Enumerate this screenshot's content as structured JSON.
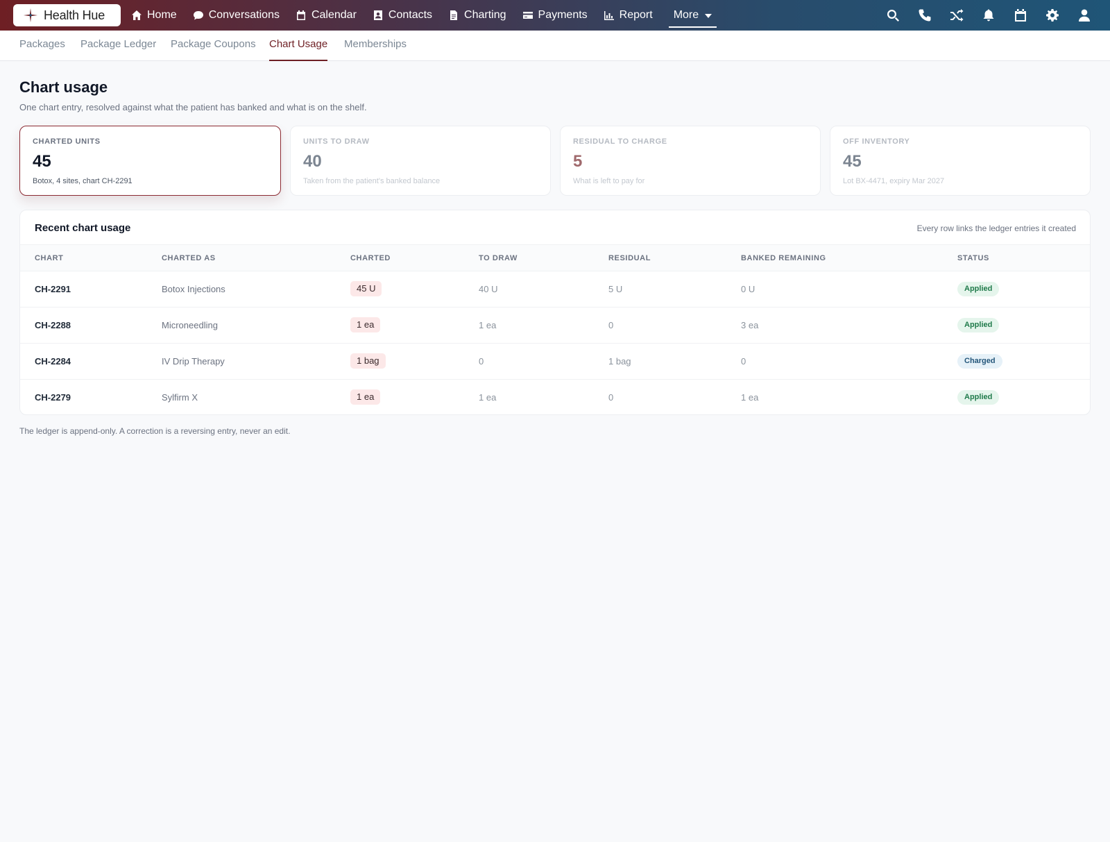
{
  "app": {
    "name": "Health Hue"
  },
  "nav": {
    "items": [
      {
        "label": "Home",
        "icon": "home-icon"
      },
      {
        "label": "Conversations",
        "icon": "chat-icon"
      },
      {
        "label": "Calendar",
        "icon": "calendar-icon"
      },
      {
        "label": "Contacts",
        "icon": "contacts-icon"
      },
      {
        "label": "Charting",
        "icon": "document-icon"
      },
      {
        "label": "Payments",
        "icon": "card-icon"
      },
      {
        "label": "Report",
        "icon": "bar-chart-icon"
      }
    ],
    "more_label": "More",
    "right_icons": [
      "search-icon",
      "phone-icon",
      "shuffle-icon",
      "bell-icon",
      "calendar-icon",
      "gear-icon",
      "user-icon"
    ]
  },
  "subtabs": [
    "Packages",
    "Package Ledger",
    "Package Coupons",
    "Chart Usage",
    "Memberships"
  ],
  "active_subtab": "Chart Usage",
  "page": {
    "title": "Chart usage",
    "subtitle": "One chart entry, resolved against what the patient has banked and what is on the shelf."
  },
  "cards": [
    {
      "label": "CHARTED UNITS",
      "value": "45",
      "note": "Botox, 4 sites, chart CH-2291"
    },
    {
      "label": "UNITS TO DRAW",
      "value": "40",
      "note": "Taken from the patient's banked balance"
    },
    {
      "label": "RESIDUAL TO CHARGE",
      "value": "5",
      "note": "What is left to pay for"
    },
    {
      "label": "OFF INVENTORY",
      "value": "45",
      "note": "Lot BX-4471, expiry Mar 2027"
    }
  ],
  "table": {
    "title": "Recent chart usage",
    "note": "Every row links the ledger entries it created",
    "columns": [
      "CHART",
      "CHARTED AS",
      "CHARTED",
      "TO DRAW",
      "RESIDUAL",
      "BANKED REMAINING",
      "STATUS"
    ],
    "rows": [
      {
        "chart": "CH-2291",
        "charted_as": "Botox Injections",
        "charted": "45 U",
        "to_draw": "40 U",
        "residual": "5 U",
        "banked": "0 U",
        "status": "Applied"
      },
      {
        "chart": "CH-2288",
        "charted_as": "Microneedling",
        "charted": "1 ea",
        "to_draw": "1 ea",
        "residual": "0",
        "banked": "3 ea",
        "status": "Applied"
      },
      {
        "chart": "CH-2284",
        "charted_as": "IV Drip Therapy",
        "charted": "1 bag",
        "to_draw": "0",
        "residual": "1 bag",
        "banked": "0",
        "status": "Charged"
      },
      {
        "chart": "CH-2279",
        "charted_as": "Sylfirm X",
        "charted": "1 ea",
        "to_draw": "1 ea",
        "residual": "0",
        "banked": "1 ea",
        "status": "Applied"
      }
    ]
  },
  "footnote": "The ledger is append-only. A correction is a reversing entry, never an edit.",
  "colors": {
    "brand": "#6e1f24",
    "nav_end": "#1f5577",
    "applied": "#1f7a4a",
    "charged": "#24567a"
  }
}
